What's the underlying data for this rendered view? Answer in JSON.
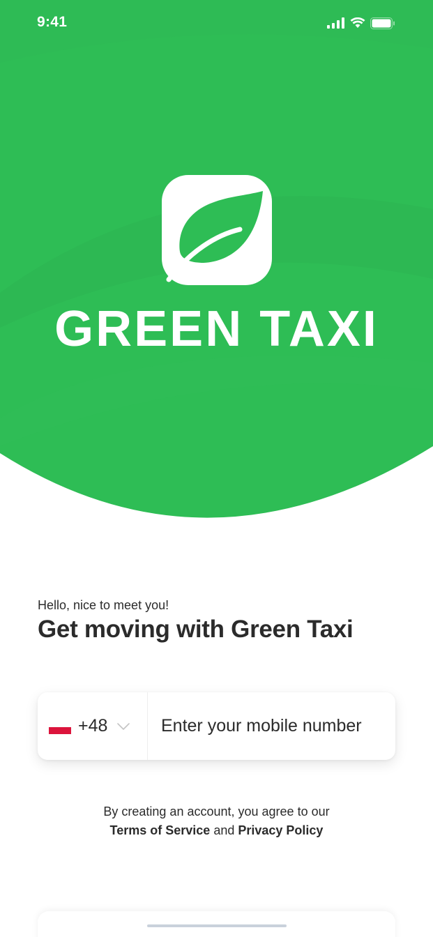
{
  "status_bar": {
    "time": "9:41"
  },
  "brand": {
    "name": "GREEN TAXI",
    "logo_icon": "leaf-icon",
    "primary_color": "#2EBD55"
  },
  "intro": {
    "greeting": "Hello, nice to meet you!",
    "headline": "Get moving with Green Taxi"
  },
  "phone_form": {
    "country_flag_icon": "poland-flag-icon",
    "dial_code": "+48",
    "placeholder": "Enter your mobile number",
    "value": ""
  },
  "terms": {
    "prefix": "By creating an account, you agree to our",
    "terms_link": "Terms of Service",
    "conjunction": "and",
    "privacy_link": "Privacy Policy"
  }
}
